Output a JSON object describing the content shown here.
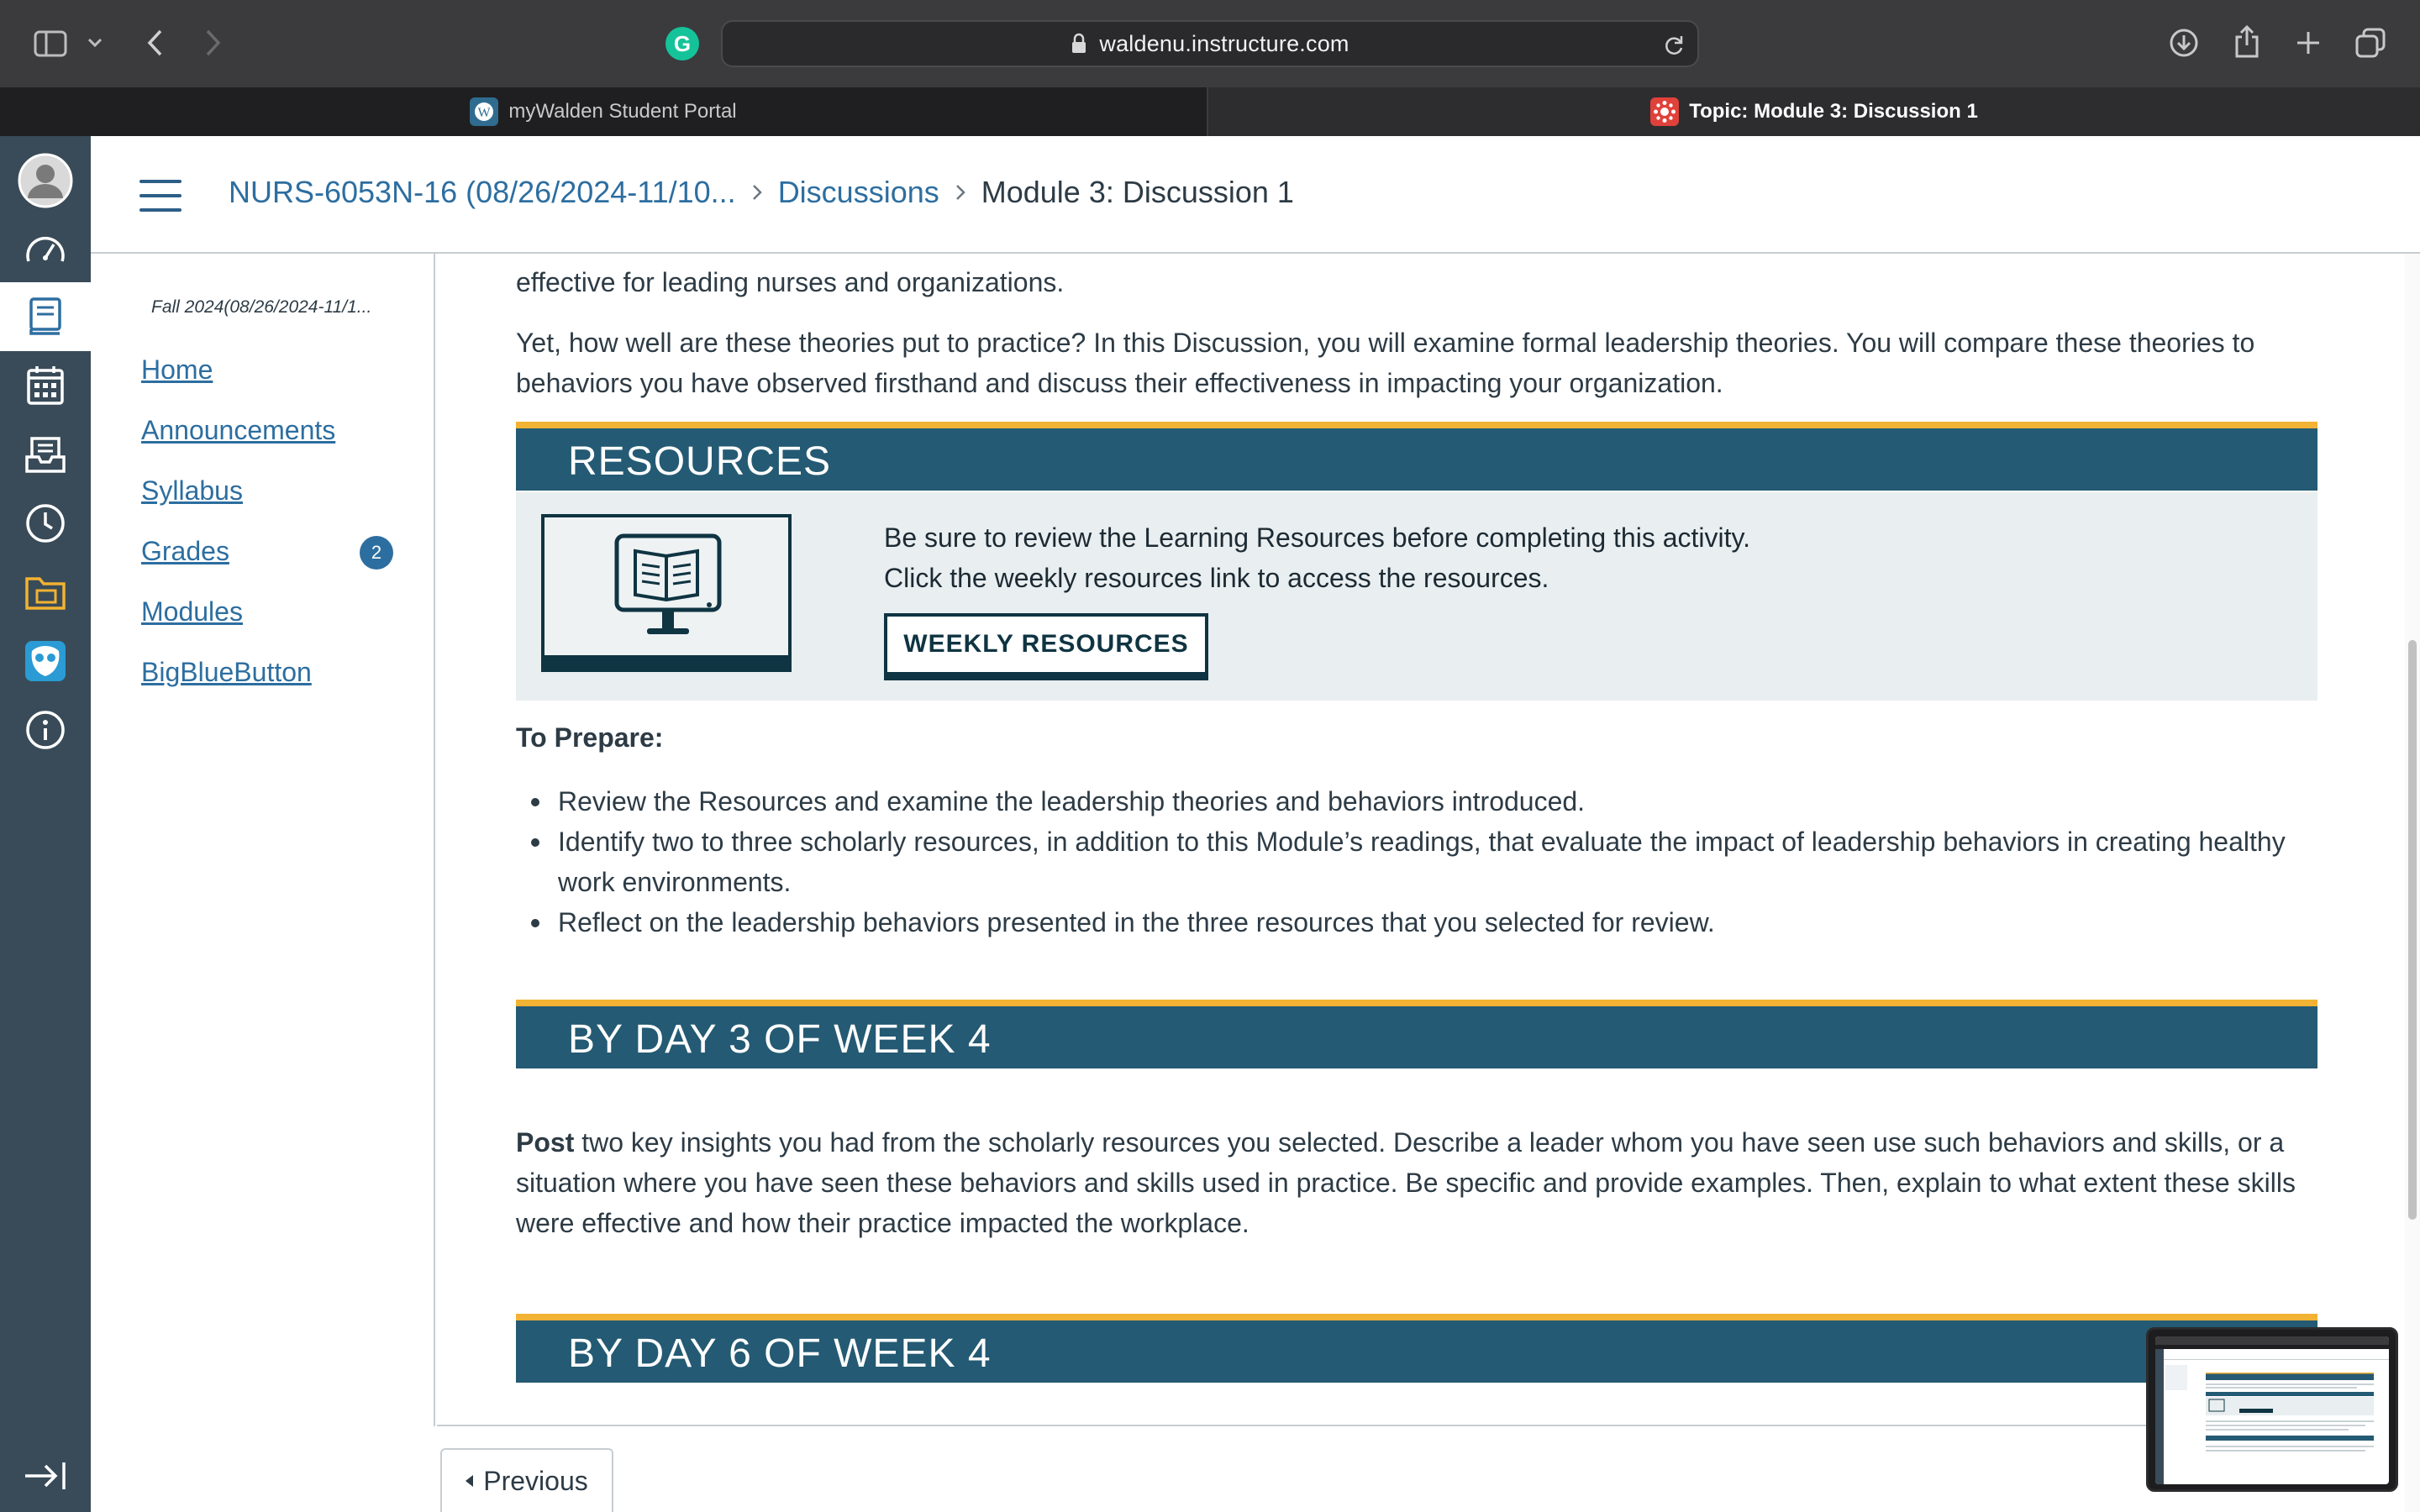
{
  "browser": {
    "url": "waldenu.instructure.com",
    "tabs": [
      {
        "label": "myWalden Student Portal",
        "active": false
      },
      {
        "label": "Topic: Module 3: Discussion 1",
        "active": true
      }
    ],
    "grammarly_letter": "G"
  },
  "breadcrumb": {
    "course": "NURS-6053N-16 (08/26/2024-11/10...",
    "section": "Discussions",
    "current": "Module 3: Discussion 1"
  },
  "course_nav": {
    "term": "Fall 2024(08/26/2024-11/1...",
    "items": [
      {
        "label": "Home"
      },
      {
        "label": "Announcements"
      },
      {
        "label": "Syllabus"
      },
      {
        "label": "Grades",
        "badge": "2"
      },
      {
        "label": "Modules"
      },
      {
        "label": "BigBlueButton"
      }
    ]
  },
  "content": {
    "intro_tail": "effective for leading nurses and organizations.",
    "intro_para": "Yet, how well are these theories put to practice? In this Discussion, you will examine formal leadership theories. You will compare these theories to behaviors you have observed firsthand and discuss their effectiveness in impacting your organization.",
    "resources": {
      "heading": "RESOURCES",
      "line1": "Be sure to review the Learning Resources before completing this activity.",
      "line2": "Click the weekly resources link to access the resources.",
      "button": "WEEKLY RESOURCES"
    },
    "prepare_heading": "To Prepare:",
    "prepare_items": [
      "Review the Resources and examine the leadership theories and behaviors introduced.",
      "Identify two to three scholarly resources, in addition to this Module’s readings, that evaluate the impact of leadership behaviors in creating healthy work environments.",
      "Reflect on the leadership behaviors presented in the three resources that you selected for review."
    ],
    "day3_heading": "BY DAY 3 OF WEEK 4",
    "day3_bold": "Post",
    "day3_text": " two key insights you had from the scholarly resources you selected. Describe a leader whom you have seen use such behaviors and skills, or a situation where you have seen these behaviors and skills used in practice. Be specific and provide examples. Then, explain to what extent these skills were effective and how their practice impacted the workplace.",
    "day6_heading": "BY DAY 6 OF WEEK 4"
  },
  "footer": {
    "previous": "Previous"
  },
  "colors": {
    "canvas_nav": "#394b58",
    "link": "#2d6ea0",
    "banner": "#245a73",
    "banner_accent": "#f2b233"
  }
}
